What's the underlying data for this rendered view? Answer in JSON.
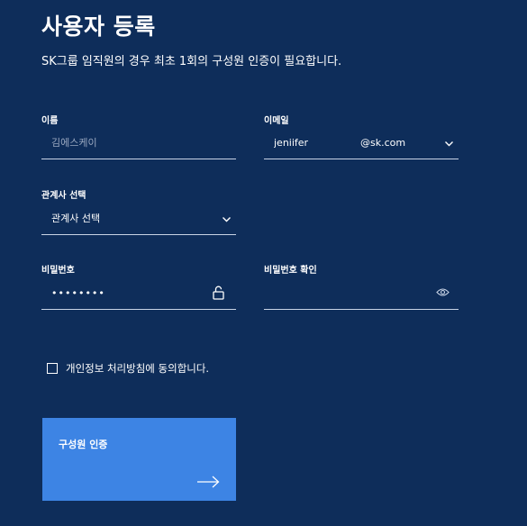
{
  "page": {
    "title": "사용자 등록",
    "subtitle": "SK그룹 임직원의 경우 최초 1회의 구성원 인증이 필요합니다."
  },
  "form": {
    "name": {
      "label": "이름",
      "placeholder": "김에스케이",
      "value": ""
    },
    "email": {
      "label": "이메일",
      "value": "jeniifer",
      "domain": "@sk.com",
      "icon": "chevron-down-icon"
    },
    "company": {
      "label": "관계사 선택",
      "selected": "관계사 선택",
      "icon": "chevron-down-icon"
    },
    "password": {
      "label": "비밀번호",
      "value": "••••••••",
      "icon": "unlock-icon"
    },
    "password_confirm": {
      "label": "비밀번호 확인",
      "value": "",
      "icon": "eye-icon"
    },
    "consent": {
      "label": "개인정보 처리방침에 동의합니다.",
      "checked": false
    }
  },
  "verify_button": {
    "label": "구성원 인증",
    "icon": "arrow-right-icon"
  },
  "colors": {
    "background": "#0e2d5a",
    "accent": "#3d84e4",
    "underline": "#c9d4e6",
    "placeholder": "#9aa8c0"
  }
}
